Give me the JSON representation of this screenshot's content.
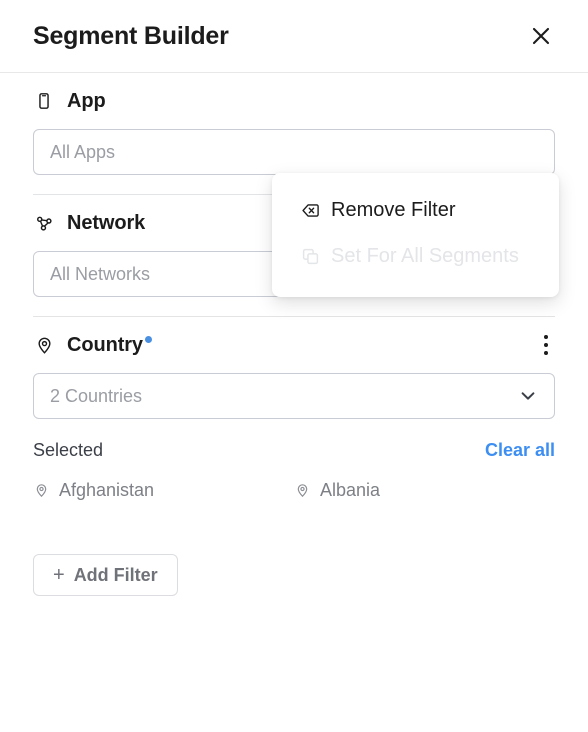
{
  "header": {
    "title": "Segment Builder",
    "close_icon": "close-icon"
  },
  "filters": [
    {
      "id": "app",
      "icon": "mobile-device-icon",
      "label": "App",
      "has_badge": false,
      "has_menu": false,
      "value": "",
      "placeholder": "All Apps",
      "has_chevron": false
    },
    {
      "id": "network",
      "icon": "network-nodes-icon",
      "label": "Network",
      "has_badge": false,
      "has_menu": true,
      "value": "",
      "placeholder": "All Networks",
      "has_chevron": true
    },
    {
      "id": "country",
      "icon": "location-pin-icon",
      "label": "Country",
      "has_badge": true,
      "has_menu": true,
      "value": "",
      "placeholder": "2 Countries",
      "has_chevron": true
    }
  ],
  "selected": {
    "label": "Selected",
    "clear_all_label": "Clear all",
    "items": [
      {
        "icon": "location-pin-icon",
        "label": "Afghanistan"
      },
      {
        "icon": "location-pin-icon",
        "label": "Albania"
      }
    ]
  },
  "add_filter": {
    "plus": "+",
    "label": "Add Filter"
  },
  "context_menu": {
    "items": [
      {
        "icon": "backspace-delete-icon",
        "label": "Remove Filter",
        "disabled": false
      },
      {
        "icon": "copy-duplicate-icon",
        "label": "Set For All Segments",
        "disabled": true
      }
    ]
  },
  "colors": {
    "accent_blue": "#3d8ef2",
    "badge_blue": "#4a90e2",
    "text_primary": "#1c1c1c",
    "text_muted": "#9a9da3",
    "border": "#c9ccd4"
  }
}
